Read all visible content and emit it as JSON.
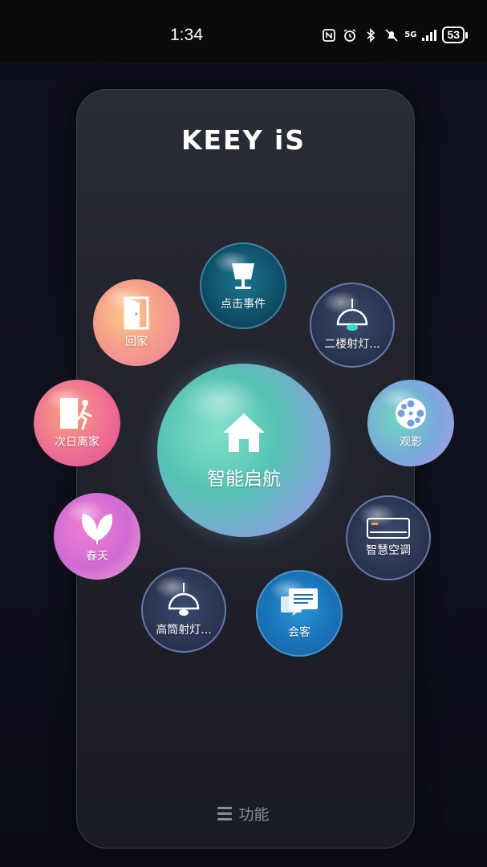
{
  "status_bar": {
    "time": "1:34",
    "network": "5G",
    "battery": "53"
  },
  "app": {
    "logo": "KEEY iS",
    "footer_label": "功能"
  },
  "scenes": {
    "center": {
      "label": "智能启航",
      "icon": "home-icon"
    },
    "dianji": {
      "label": "点击事件",
      "icon": "lamp-icon"
    },
    "huijia": {
      "label": "回家",
      "icon": "door-icon"
    },
    "erlou": {
      "label": "二楼射灯...",
      "icon": "pendant-light-icon"
    },
    "ciri": {
      "label": "次日离家",
      "icon": "leave-home-icon"
    },
    "guanying": {
      "label": "观影",
      "icon": "film-reel-icon"
    },
    "chuntian": {
      "label": "春天",
      "icon": "leaf-icon"
    },
    "zhihui": {
      "label": "智慧空调",
      "icon": "air-conditioner-icon"
    },
    "gaotong": {
      "label": "高筒射灯...",
      "icon": "pendant-light-icon"
    },
    "huike": {
      "label": "会客",
      "icon": "chat-icon"
    }
  },
  "colors": {
    "background": "#0e0f1b",
    "panel": "#22232c",
    "center_bubble": "#56c2b4"
  }
}
